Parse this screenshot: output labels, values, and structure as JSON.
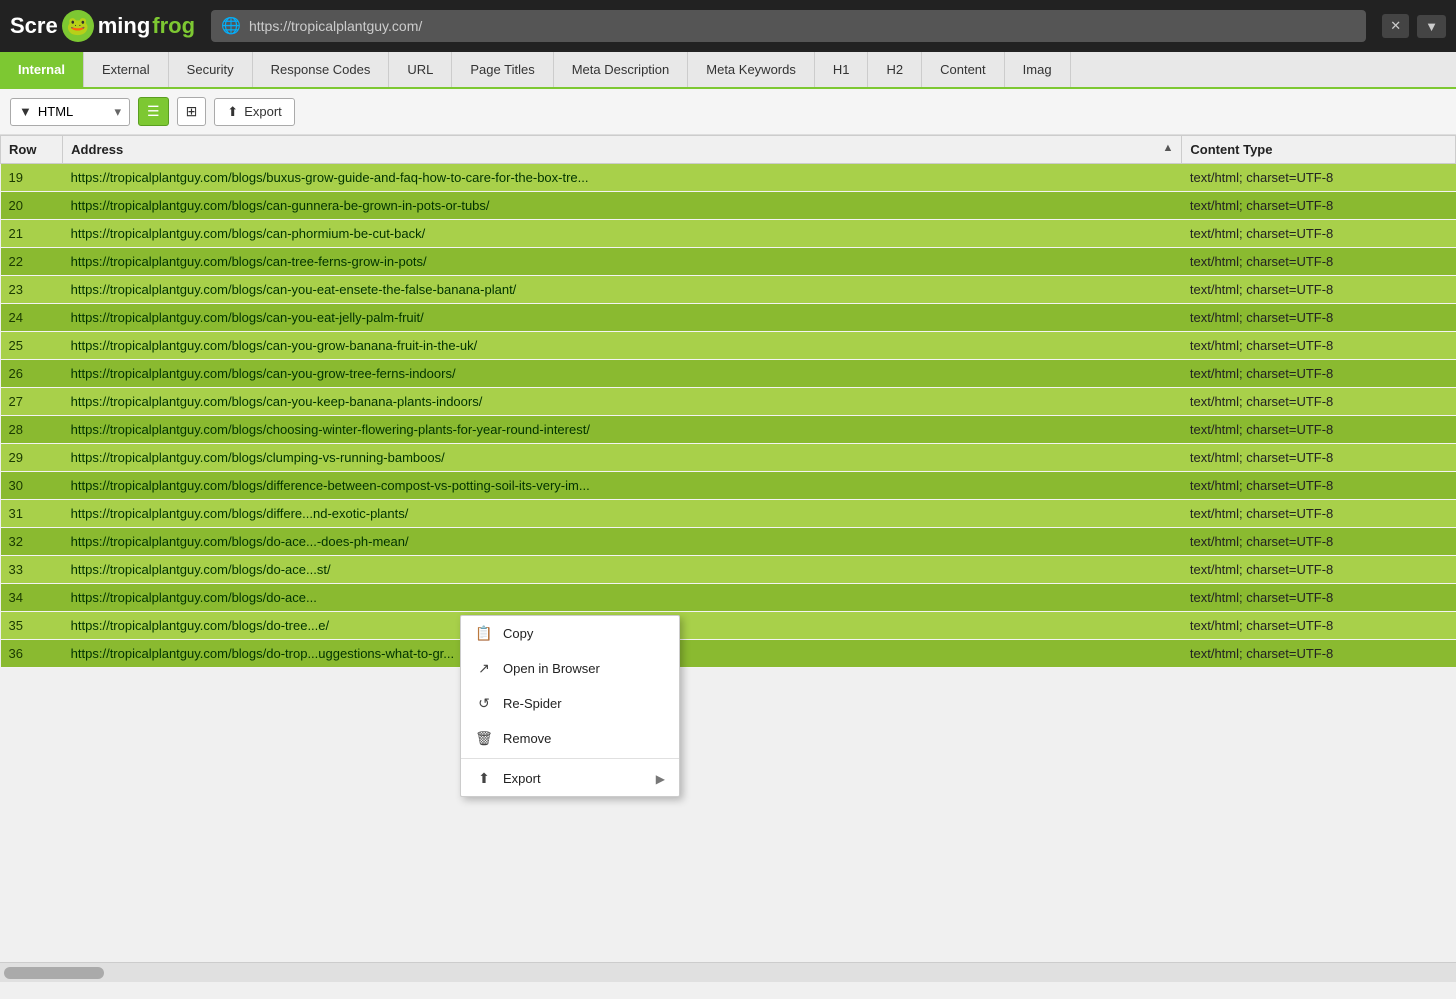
{
  "header": {
    "logo_text_scre": "Scre",
    "logo_text_ming": "ming",
    "logo_text_frog": "frog",
    "url": "https://tropicalplantguy.com/",
    "close_btn": "✕",
    "nav_btn": "▼"
  },
  "tabs": [
    {
      "label": "Internal",
      "active": true
    },
    {
      "label": "External",
      "active": false
    },
    {
      "label": "Security",
      "active": false
    },
    {
      "label": "Response Codes",
      "active": false
    },
    {
      "label": "URL",
      "active": false
    },
    {
      "label": "Page Titles",
      "active": false
    },
    {
      "label": "Meta Description",
      "active": false
    },
    {
      "label": "Meta Keywords",
      "active": false
    },
    {
      "label": "H1",
      "active": false
    },
    {
      "label": "H2",
      "active": false
    },
    {
      "label": "Content",
      "active": false
    },
    {
      "label": "Imag",
      "active": false
    }
  ],
  "toolbar": {
    "filter_icon": "▼",
    "filter_label": "HTML",
    "list_view_icon": "☰",
    "tree_view_icon": "⊞",
    "export_label": "Export",
    "export_icon": "⬆"
  },
  "table": {
    "columns": [
      {
        "label": "Row",
        "key": "row"
      },
      {
        "label": "Address",
        "key": "address",
        "sortable": true,
        "sort": "asc"
      },
      {
        "label": "Content Type",
        "key": "content_type"
      }
    ],
    "rows": [
      {
        "row": 19,
        "address": "https://tropicalplantguy.com/blogs/buxus-grow-guide-and-faq-how-to-care-for-the-box-tre...",
        "content_type": "text/html; charset=UTF-8"
      },
      {
        "row": 20,
        "address": "https://tropicalplantguy.com/blogs/can-gunnera-be-grown-in-pots-or-tubs/",
        "content_type": "text/html; charset=UTF-8"
      },
      {
        "row": 21,
        "address": "https://tropicalplantguy.com/blogs/can-phormium-be-cut-back/",
        "content_type": "text/html; charset=UTF-8"
      },
      {
        "row": 22,
        "address": "https://tropicalplantguy.com/blogs/can-tree-ferns-grow-in-pots/",
        "content_type": "text/html; charset=UTF-8"
      },
      {
        "row": 23,
        "address": "https://tropicalplantguy.com/blogs/can-you-eat-ensete-the-false-banana-plant/",
        "content_type": "text/html; charset=UTF-8"
      },
      {
        "row": 24,
        "address": "https://tropicalplantguy.com/blogs/can-you-eat-jelly-palm-fruit/",
        "content_type": "text/html; charset=UTF-8"
      },
      {
        "row": 25,
        "address": "https://tropicalplantguy.com/blogs/can-you-grow-banana-fruit-in-the-uk/",
        "content_type": "text/html; charset=UTF-8"
      },
      {
        "row": 26,
        "address": "https://tropicalplantguy.com/blogs/can-you-grow-tree-ferns-indoors/",
        "content_type": "text/html; charset=UTF-8"
      },
      {
        "row": 27,
        "address": "https://tropicalplantguy.com/blogs/can-you-keep-banana-plants-indoors/",
        "content_type": "text/html; charset=UTF-8"
      },
      {
        "row": 28,
        "address": "https://tropicalplantguy.com/blogs/choosing-winter-flowering-plants-for-year-round-interest/",
        "content_type": "text/html; charset=UTF-8"
      },
      {
        "row": 29,
        "address": "https://tropicalplantguy.com/blogs/clumping-vs-running-bamboos/",
        "content_type": "text/html; charset=UTF-8"
      },
      {
        "row": 30,
        "address": "https://tropicalplantguy.com/blogs/difference-between-compost-vs-potting-soil-its-very-im...",
        "content_type": "text/html; charset=UTF-8"
      },
      {
        "row": 31,
        "address": "https://tropicalplantguy.com/blogs/differe...nd-exotic-plants/",
        "content_type": "text/html; charset=UTF-8"
      },
      {
        "row": 32,
        "address": "https://tropicalplantguy.com/blogs/do-ace...-does-ph-mean/",
        "content_type": "text/html; charset=UTF-8"
      },
      {
        "row": 33,
        "address": "https://tropicalplantguy.com/blogs/do-ace...st/",
        "content_type": "text/html; charset=UTF-8"
      },
      {
        "row": 34,
        "address": "https://tropicalplantguy.com/blogs/do-ace...",
        "content_type": "text/html; charset=UTF-8"
      },
      {
        "row": 35,
        "address": "https://tropicalplantguy.com/blogs/do-tree...e/",
        "content_type": "text/html; charset=UTF-8"
      },
      {
        "row": 36,
        "address": "https://tropicalplantguy.com/blogs/do-trop...uggestions-what-to-gr...",
        "content_type": "text/html; charset=UTF-8"
      }
    ]
  },
  "context_menu": {
    "items": [
      {
        "label": "Copy",
        "icon": "📋",
        "has_arrow": false
      },
      {
        "label": "Open in Browser",
        "icon": "↗",
        "has_arrow": false
      },
      {
        "label": "Re-Spider",
        "icon": "↺",
        "has_arrow": false
      },
      {
        "label": "Remove",
        "icon": "🗑",
        "has_arrow": false
      },
      {
        "label": "Export",
        "icon": "⬆",
        "has_arrow": true
      }
    ]
  },
  "colors": {
    "green_active": "#7dc832",
    "green_row_odd": "#a8d04a",
    "green_row_even": "#8aba30",
    "tab_active_bg": "#7dc832"
  }
}
